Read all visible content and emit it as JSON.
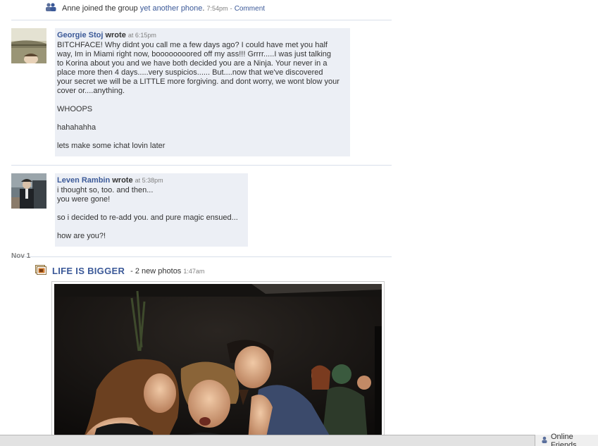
{
  "group_story": {
    "actor": "Anne joined the group",
    "group_link": "yet another phone",
    "period": ".",
    "time": "7:54pm",
    "dash": "-",
    "comment_label": "Comment",
    "icon": "group-icon"
  },
  "posts": [
    {
      "author": "Georgie Stoj",
      "wrote": "wrote",
      "time": "at 6:15pm",
      "body": "BITCHFACE! Why didnt you call me a few days ago? I could have met you half\nway, Im in Miami right now, boooooooored off my ass!!! Grrrr.....I was just talking\nto Korina about you and we have both decided you are a Ninja. Your never in a\nplace more then 4 days.....very suspicios...... But....now that we've discovered\nyour secret we will be a LITTLE more forgiving. and dont worry, we wont blow your\ncover or....anything.\n\nWHOOPS\n\nhahahahha\n\nlets make some ichat lovin later"
    },
    {
      "author": "Leven Rambin",
      "wrote": "wrote",
      "time": "at 5:38pm",
      "body": "i thought so, too. and then...\nyou were gone!\n\nso i decided to re-add you. and pure magic ensued...\n\nhow are you?!"
    }
  ],
  "date_label": "Nov 1",
  "photo_story": {
    "icon": "photo-album-icon",
    "album_title": "LIFE IS BIGGER",
    "meta": "- 2 new photos",
    "time": "1:47am"
  },
  "footer": {
    "online_friends": "Online Friends",
    "icon": "friends-icon"
  },
  "colors": {
    "link": "#3b5998",
    "bubble": "#eceff5",
    "separator": "#d8dfea"
  }
}
